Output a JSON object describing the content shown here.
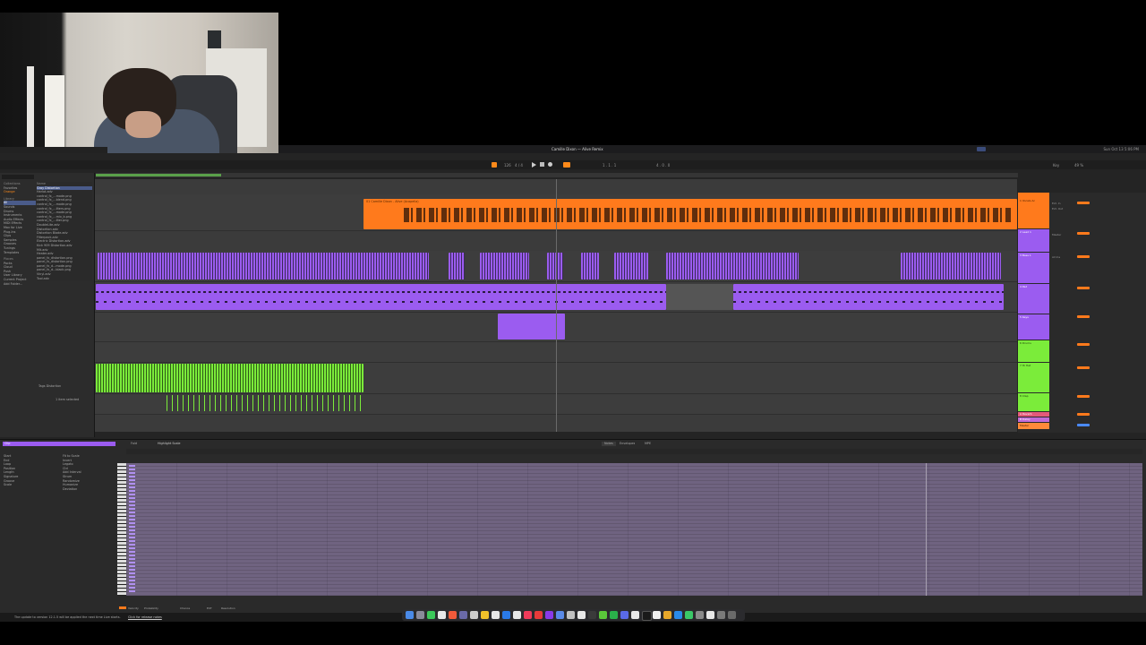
{
  "menubar": {
    "title": "Camille Dixon — Alive Remix",
    "clock": "Sun Oct 13  5:06 PM"
  },
  "transport": {
    "bpm": "126",
    "signature": "4 / 4",
    "position": "1 . 1 . 1",
    "loop_len": "4 . 0 . 0",
    "key": "Key",
    "cpu": "49 %"
  },
  "browser": {
    "search_placeholder": "Search",
    "collections_title": "Collections",
    "collections": [
      "Favorites",
      "Orange"
    ],
    "library_title": "Library",
    "library": [
      "All",
      "Sounds",
      "Drums",
      "Instruments",
      "Audio Effects",
      "MIDI Effects",
      "Max for Live",
      "Plug-Ins",
      "Clips",
      "Samples",
      "Grooves",
      "Tunings",
      "Templates"
    ],
    "places_title": "Places",
    "places": [
      "Packs",
      "Cloud",
      "Push",
      "User Library",
      "Current Project",
      "Add Folder..."
    ],
    "col_title": "Name",
    "files": [
      "Gray Distortion",
      "Harlot.adv",
      "control_fx_...mode.png",
      "control_fx_...blend.png",
      "control_fx_...mode.png",
      "control_fx_...ilters.png",
      "control_fx_...mode.png",
      "control_fx_...mix_b.png",
      "control_fx_...ilter.png",
      "DoubleLite.adv",
      "Distortion.adv",
      "Distortion Blade.adv",
      "Filterpack.adv",
      "Electric Distortion.adv",
      "Kick 909 Distortion.adv",
      "Mit.adv",
      "Heater.adv",
      "panel_fx_distortion.png",
      "panel_fx_distortion.png",
      "panel_fx_d...mode.png",
      "panel_fx_d...black.png",
      "Vinyl.adv",
      "Tool.adv"
    ],
    "tags": "Tags  Distortion",
    "footer": "1 item selected"
  },
  "arrangement": {
    "audio_clip_label": "01 Camille Dixon - Alive (Acapella)"
  },
  "mixer": {
    "tracks": [
      "1 Vocals Ac",
      "2 Lead 1",
      "3 Bass 1",
      "4 Pad",
      "5 Keys",
      "6 Drums",
      "7 Hi Hat",
      "8 Clap",
      "A Reverb",
      "B Delay",
      "Master"
    ],
    "routing": [
      "Ext. In",
      "Ext. Out",
      "Master",
      "All Ins"
    ]
  },
  "detail": {
    "tabs": [
      "Fold",
      "Highlight Scale"
    ],
    "right_tabs": [
      "Notes",
      "Envelopes",
      "MPE"
    ],
    "clip_name": "Clip",
    "props": [
      "Start",
      "End",
      "Loop",
      "Position",
      "Length",
      "Signature",
      "Groove",
      "Scale"
    ],
    "options": [
      "Fit to Scale",
      "Invert",
      "Legato",
      "Ctrl",
      "Add Interval",
      "Strum",
      "Randomize",
      "Humanize",
      "Deviation"
    ]
  },
  "status_bar": {
    "update": "The update to version 12.1.5 will be applied the next time Live starts.",
    "notes_link": "Click for release notes"
  },
  "bottom_bar": {
    "velocity": "Velocity",
    "probability": "Probability",
    "chance": "Chance",
    "ext": "EXT",
    "resolution": "Resolution"
  },
  "colors": {
    "audio": "#ff7a1c",
    "midi": "#9b5cf0",
    "drums": "#7bec3a",
    "piano_roll": "#6f6380"
  }
}
